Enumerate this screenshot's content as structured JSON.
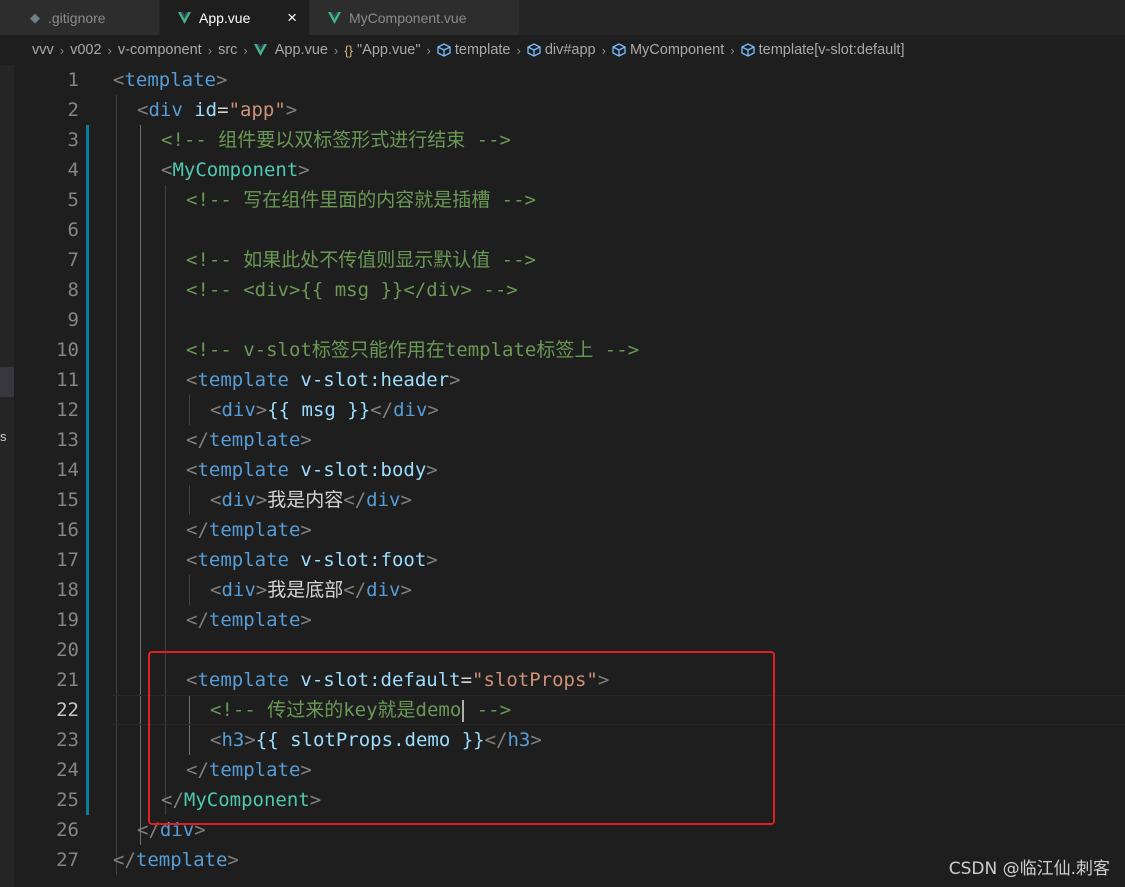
{
  "tabs": [
    {
      "label": ".gitignore",
      "icon": "git-file-icon",
      "active": false
    },
    {
      "label": "App.vue",
      "icon": "vue-icon",
      "active": true,
      "close": "×"
    },
    {
      "label": "MyComponent.vue",
      "icon": "vue-icon",
      "active": false
    }
  ],
  "breadcrumb": {
    "items": [
      "vvv",
      "v002",
      "v-component",
      "src",
      "App.vue",
      "\"App.vue\"",
      "template",
      "div#app",
      "MyComponent",
      "template[v-slot:default]"
    ],
    "braces_glyph": "{}"
  },
  "editor": {
    "active_line": 22,
    "lines": [
      {
        "n": "1"
      },
      {
        "n": "2"
      },
      {
        "n": "3"
      },
      {
        "n": "4"
      },
      {
        "n": "5"
      },
      {
        "n": "6"
      },
      {
        "n": "7"
      },
      {
        "n": "8"
      },
      {
        "n": "9"
      },
      {
        "n": "10"
      },
      {
        "n": "11"
      },
      {
        "n": "12"
      },
      {
        "n": "13"
      },
      {
        "n": "14"
      },
      {
        "n": "15"
      },
      {
        "n": "16"
      },
      {
        "n": "17"
      },
      {
        "n": "18"
      },
      {
        "n": "19"
      },
      {
        "n": "20"
      },
      {
        "n": "21"
      },
      {
        "n": "22"
      },
      {
        "n": "23"
      },
      {
        "n": "24"
      },
      {
        "n": "25"
      },
      {
        "n": "26"
      },
      {
        "n": "27"
      }
    ],
    "tok": {
      "lt": "<",
      "gt": ">",
      "ltslash": "</",
      "eq": "=",
      "colon": ":",
      "template": "template",
      "div": "div",
      "h3": "h3",
      "mycomponent": "MyComponent",
      "attr_id": "id",
      "val_app": "\"app\"",
      "c3": "<!-- 组件要以双标签形式进行结束 -->",
      "c5": "<!-- 写在组件里面的内容就是插槽 -->",
      "c7": "<!-- 如果此处不传值则显示默认值 -->",
      "c8": "<!-- <div>{{ msg }}</div> -->",
      "c10": "<!-- v-slot标签只能作用在template标签上 -->",
      "vslot": "v-slot",
      "header": "header",
      "body": "body",
      "foot": "foot",
      "default": "default",
      "slotprops_val": "\"slotProps\"",
      "mustache_msg": "{{ msg }}",
      "txt15": "我是内容",
      "txt18": "我是底部",
      "c22a": "<!-- 传过来的key就是demo",
      "c22b": " -->",
      "mustache_demo": "{{ slotProps.demo }}"
    }
  },
  "watermark": "CSDN @临江仙.刺客",
  "colors": {
    "keyword": "#569cd6",
    "component": "#4ec9b0",
    "attribute": "#9cdcfe",
    "string": "#ce9178",
    "comment": "#6a9955",
    "annotation": "#e02020"
  }
}
